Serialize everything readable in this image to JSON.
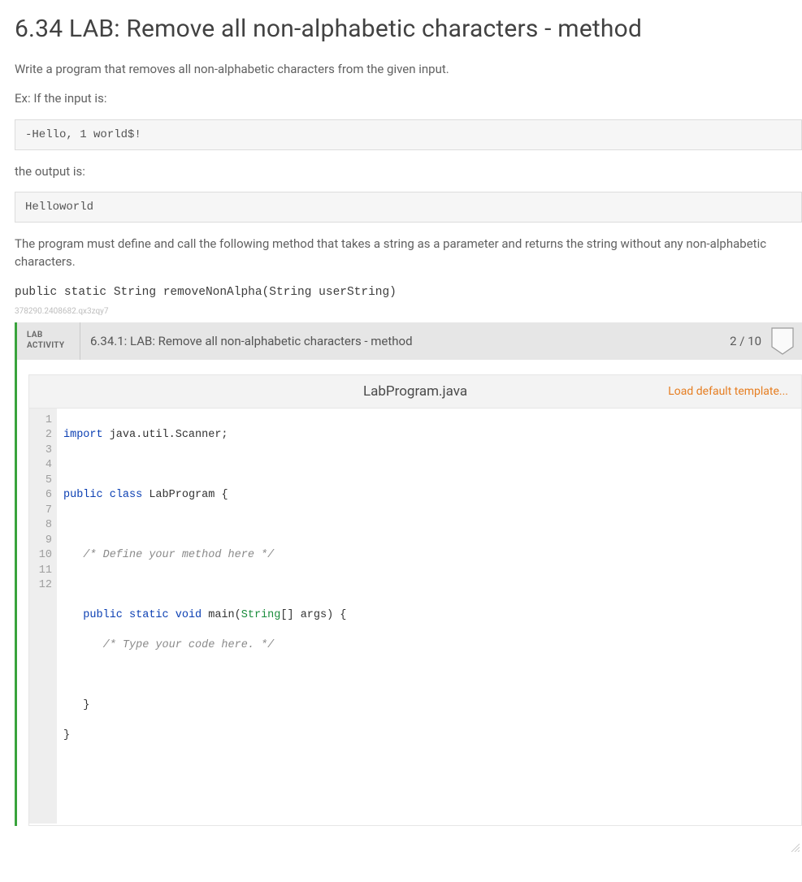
{
  "header": {
    "title": "6.34 LAB: Remove all non-alphabetic characters - method"
  },
  "prose": {
    "intro": "Write a program that removes all non-alphabetic characters from the given input.",
    "ex_input_label": "Ex: If the input is:",
    "example_input": "-Hello, 1 world$!",
    "output_label": "the output is:",
    "example_output": "Helloworld",
    "requirement": "The program must define and call the following method that takes a string as a parameter and returns the string without any non-alphabetic characters.",
    "signature": "public static String removeNonAlpha(String userString)"
  },
  "meta": {
    "tiny_id": "378290.2408682.qx3zqy7"
  },
  "activity": {
    "badge_line1": "LAB",
    "badge_line2": "ACTIVITY",
    "title": "6.34.1: LAB: Remove all non-alphabetic characters - method",
    "score": "2 / 10"
  },
  "editor": {
    "filename": "LabProgram.java",
    "load_template": "Load default template...",
    "gutter": [
      "1",
      "2",
      "3",
      "4",
      "5",
      "6",
      "7",
      "8",
      "9",
      "10",
      "11",
      "12"
    ],
    "code": {
      "l1_kw": "import",
      "l1_rest": " java.util.Scanner;",
      "l3_a": "public",
      "l3_b": "class",
      "l3_c": " LabProgram {",
      "l5_cmt": "   /* Define your method here */",
      "l7_a": "   public",
      "l7_b": "static",
      "l7_c": "void",
      "l7_fn": " main",
      "l7_p1": "(",
      "l7_typ": "String",
      "l7_p2": "[] args) {",
      "l8_cmt": "      /* Type your code here. */",
      "l10": "   }",
      "l11": "}"
    }
  }
}
